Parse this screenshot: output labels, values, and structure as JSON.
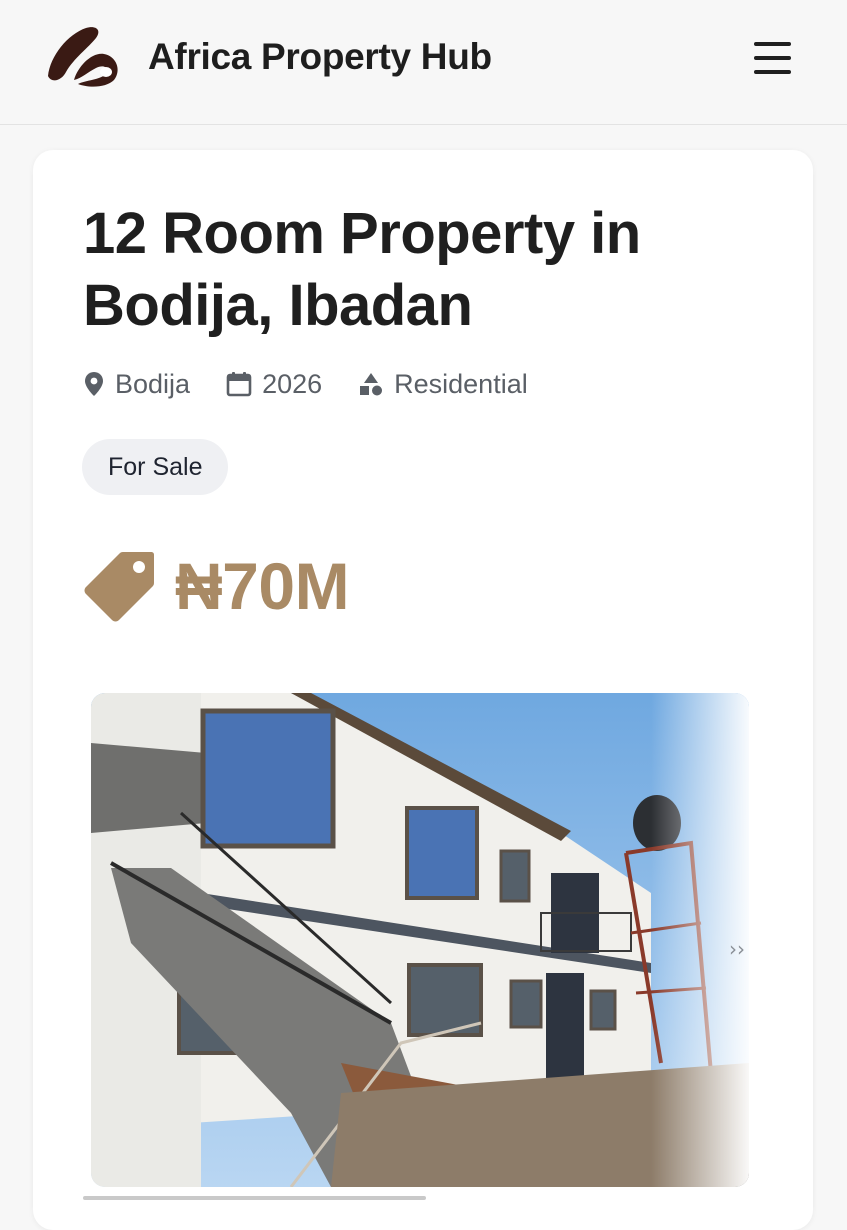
{
  "header": {
    "brand_name": "Africa Property Hub",
    "logo_icon": "aph-logo-icon",
    "menu_icon": "hamburger-menu-icon",
    "brand_color": "#3a1a14"
  },
  "listing": {
    "title": "12 Room Property in Bodija, Ibadan",
    "location": "Bodija",
    "year": "2026",
    "category": "Residential",
    "status_badge": "For Sale",
    "price": "₦70M",
    "price_color": "#a98a65",
    "icons": {
      "location": "location-pin-icon",
      "year": "calendar-icon",
      "category": "shapes-icon",
      "price": "price-tag-icon"
    },
    "photo": {
      "description_icon": "building-photo",
      "next_indicator": "››"
    }
  }
}
